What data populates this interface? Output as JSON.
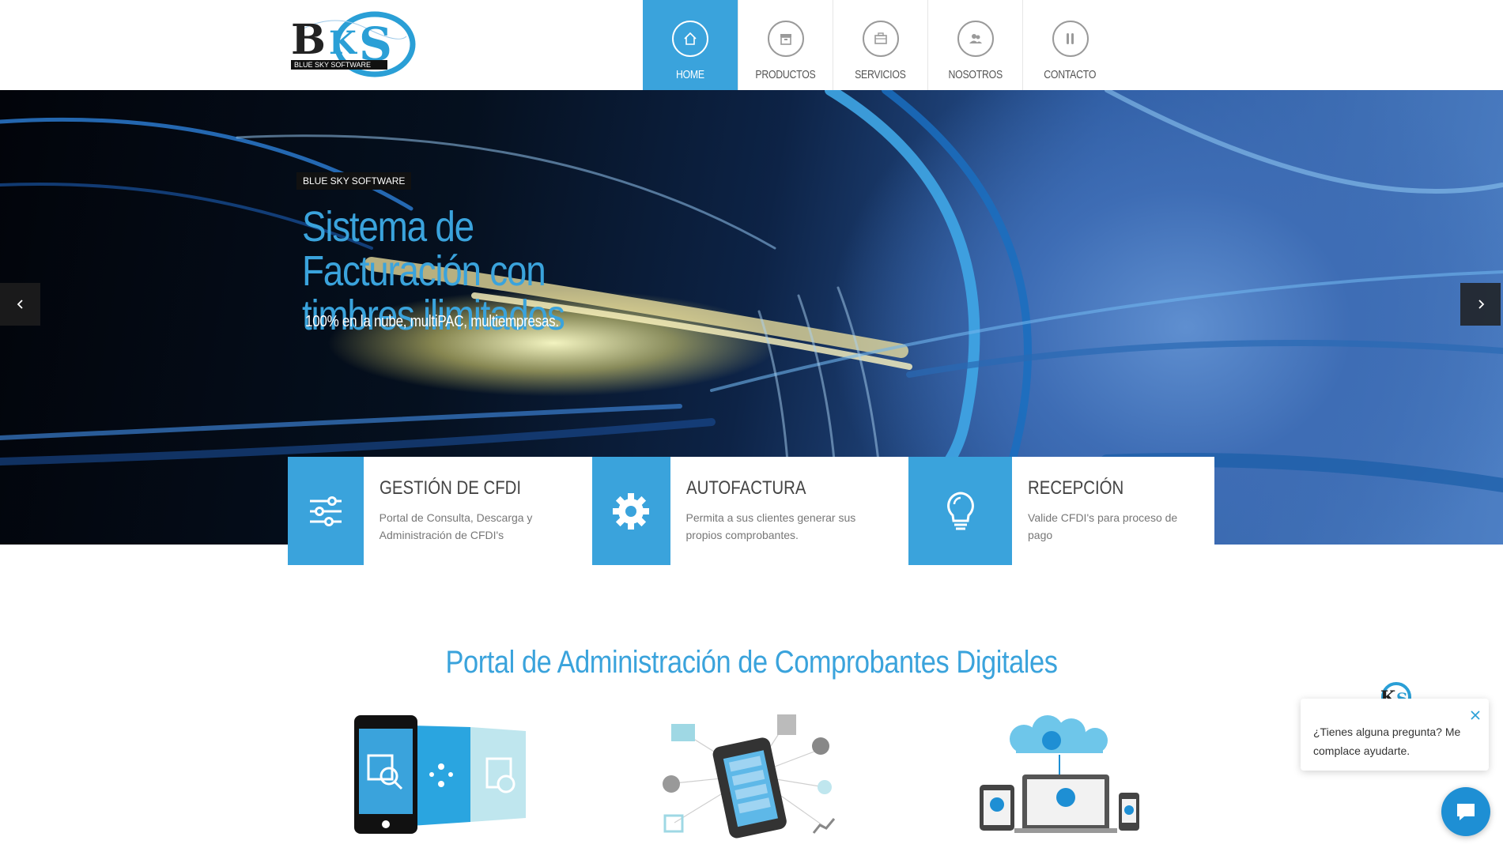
{
  "brand": {
    "logo_letters": "BKS",
    "logo_text": "BLUE SKY SOFTWARE",
    "accent": "#3aa3dc"
  },
  "nav": [
    {
      "label": "HOME",
      "icon": "home-icon",
      "active": true
    },
    {
      "label": "PRODUCTOS",
      "icon": "box-icon",
      "active": false
    },
    {
      "label": "SERVICIOS",
      "icon": "briefcase-icon",
      "active": false
    },
    {
      "label": "NOSOTROS",
      "icon": "users-icon",
      "active": false
    },
    {
      "label": "CONTACTO",
      "icon": "utensils-icon",
      "active": false
    }
  ],
  "hero": {
    "tag": "BLUE SKY SOFTWARE",
    "title": "Sistema de Facturación con timbres ilimitados",
    "subtitle": "100% en la nube, multiPAC, multiempresas."
  },
  "features": [
    {
      "title": "GESTIÓN DE CFDI",
      "desc": "Portal de Consulta, Descarga y Administración de CFDI's",
      "icon": "sliders-icon"
    },
    {
      "title": "AUTOFACTURA",
      "desc": "Permita a sus clientes generar sus propios comprobantes.",
      "icon": "gear-icon"
    },
    {
      "title": "RECEPCIÓN",
      "desc": "Valide CFDI's para proceso de pago",
      "icon": "lightbulb-icon"
    }
  ],
  "section": {
    "title": "Portal de Administración de Comprobantes Digitales"
  },
  "chat": {
    "message": "¿Tienes alguna pregunta? Me complace ayudarte."
  }
}
